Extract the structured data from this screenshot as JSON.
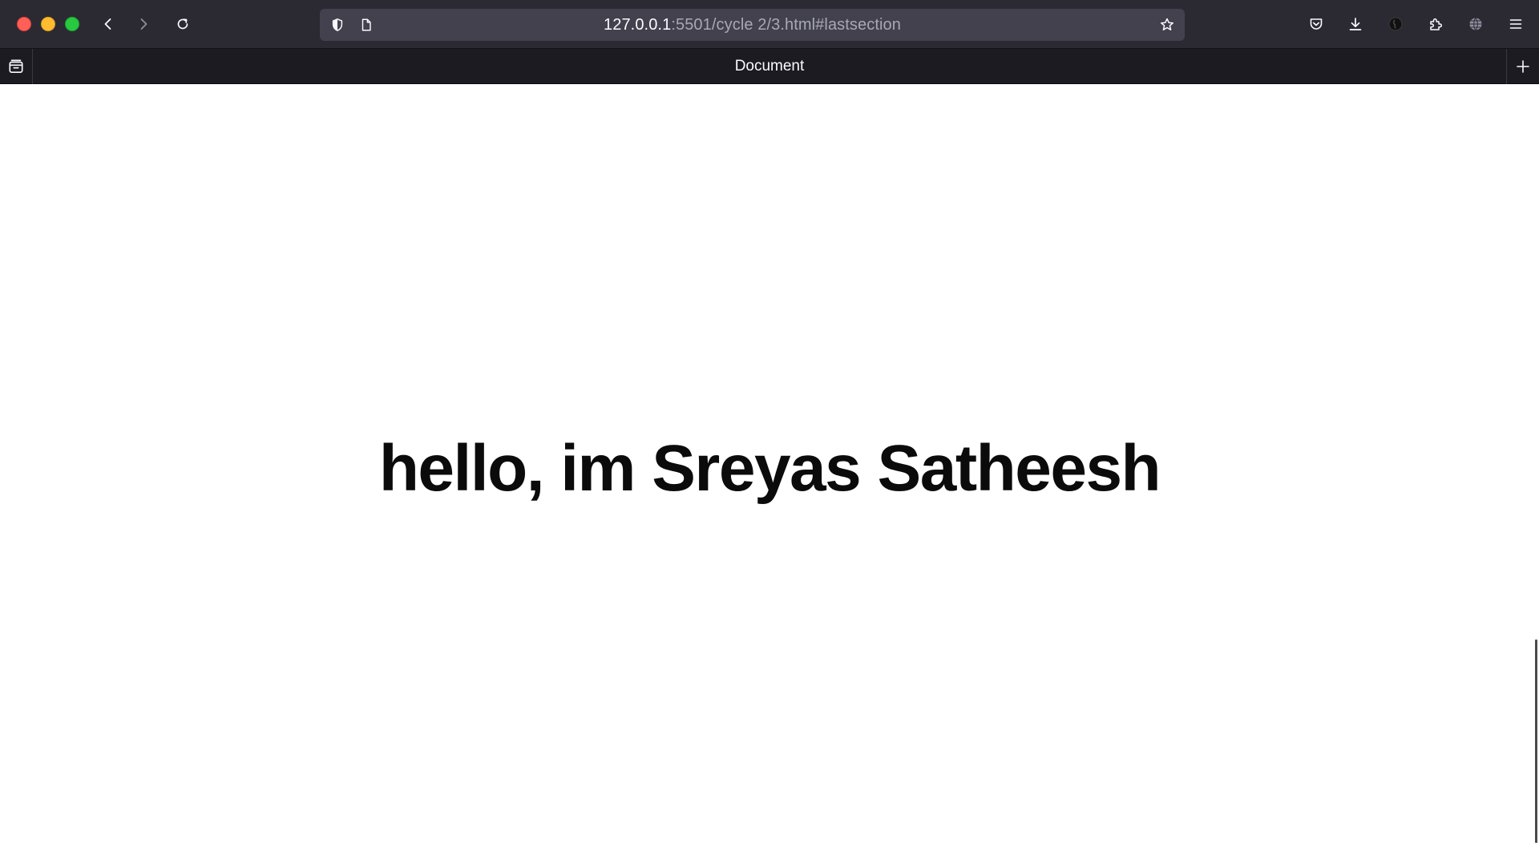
{
  "browser": {
    "url_host": "127.0.0.1",
    "url_rest": ":5501/cycle 2/3.html#lastsection",
    "icons": {
      "back": "back-arrow-icon",
      "forward": "forward-arrow-icon",
      "reload": "reload-icon",
      "tracking": "shield-icon",
      "page": "page-icon",
      "bookmark": "star-icon",
      "pocket": "pocket-icon",
      "downloads": "download-icon",
      "account": "account-icon",
      "extensions": "puzzle-icon",
      "translate": "globe-icon",
      "menu": "hamburger-menu-icon"
    }
  },
  "tabs": [
    {
      "title": "Document"
    }
  ],
  "page": {
    "heading": "hello, im Sreyas Satheesh"
  },
  "colors": {
    "toolbar_bg": "#2b2a33",
    "tabstrip_bg": "#1c1b22",
    "urlbar_bg": "#42414d",
    "heading": "#0b0b0b"
  }
}
